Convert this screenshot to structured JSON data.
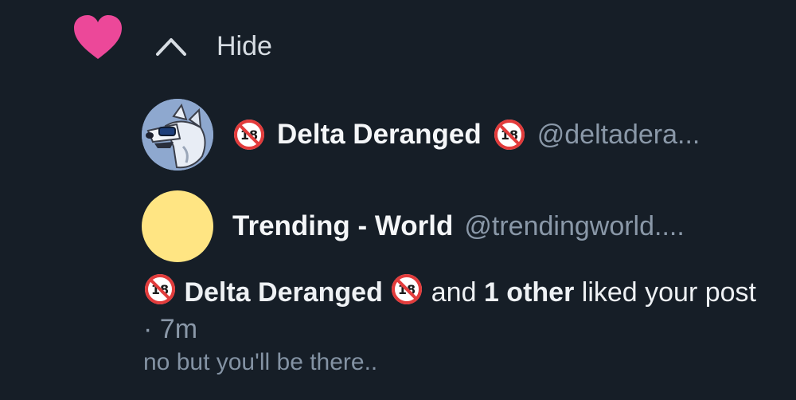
{
  "notification": {
    "toggle_label": "Hide",
    "icons": {
      "heart": "heart-icon",
      "chevron": "chevron-up-icon",
      "badge": "no-under-18-icon"
    },
    "colors": {
      "heart": "#ec4899",
      "background": "#161e27",
      "muted": "#8a98a8"
    },
    "actors": [
      {
        "name": "Delta Deranged",
        "handle": "@deltadera...",
        "avatar": "cartoon-wolf-avatar"
      },
      {
        "name": "Trending - World",
        "handle": "@trendingworld....",
        "avatar": "yellow-circle-avatar"
      }
    ],
    "summary": {
      "actor": "Delta Deranged",
      "and": "and",
      "others": "1 other",
      "action": "liked your post",
      "separator": "·",
      "time": "7m"
    },
    "post_preview": "no but you'll be there.."
  }
}
